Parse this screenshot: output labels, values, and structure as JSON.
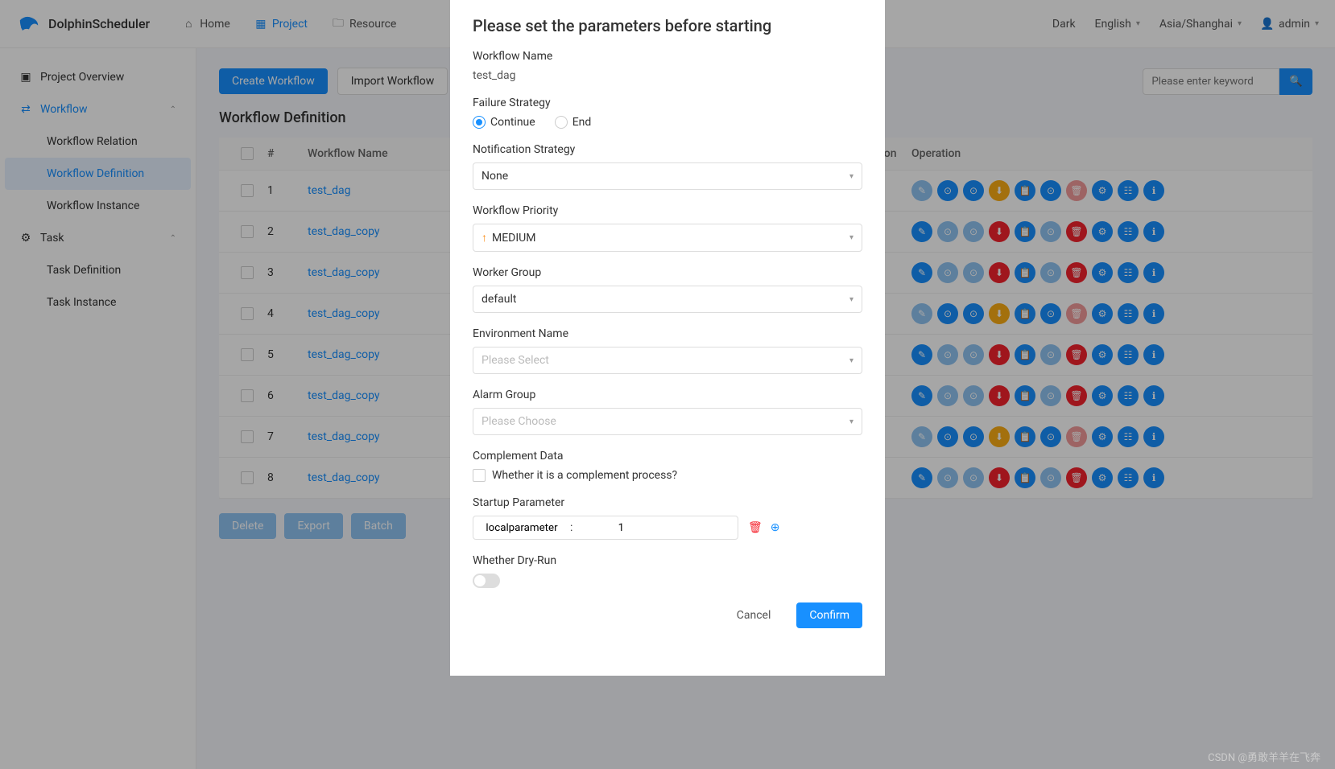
{
  "brand": "DolphinScheduler",
  "topnav": {
    "home": "Home",
    "project": "Project",
    "resource": "Resource"
  },
  "topright": {
    "dark": "Dark",
    "lang": "English",
    "tz": "Asia/Shanghai",
    "user": "admin"
  },
  "sidebar": {
    "overview": "Project Overview",
    "workflow": "Workflow",
    "workflow_relation": "Workflow Relation",
    "workflow_definition": "Workflow Definition",
    "workflow_instance": "Workflow Instance",
    "task": "Task",
    "task_definition": "Task Definition",
    "task_instance": "Task Instance"
  },
  "page": {
    "title": "Workflow Definition",
    "create_btn": "Create Workflow",
    "import_btn": "Import Workflow",
    "search_placeholder": "Please enter keyword",
    "cols": {
      "num": "#",
      "name": "Workflow Name",
      "desc": "Description",
      "op": "Operation"
    },
    "rows": [
      {
        "n": "1",
        "name": "test_dag",
        "variant": "a"
      },
      {
        "n": "2",
        "name": "test_dag_copy",
        "variant": "b"
      },
      {
        "n": "3",
        "name": "test_dag_copy",
        "variant": "b"
      },
      {
        "n": "4",
        "name": "test_dag_copy",
        "variant": "a"
      },
      {
        "n": "5",
        "name": "test_dag_copy",
        "variant": "b"
      },
      {
        "n": "6",
        "name": "test_dag_copy",
        "variant": "b"
      },
      {
        "n": "7",
        "name": "test_dag_copy",
        "variant": "a"
      },
      {
        "n": "8",
        "name": "test_dag_copy",
        "variant": "b"
      }
    ],
    "footer": {
      "delete": "Delete",
      "export": "Export",
      "batch": "Batch"
    }
  },
  "modal": {
    "title": "Please set the parameters before starting",
    "workflow_name_label": "Workflow Name",
    "workflow_name_value": "test_dag",
    "failure_label": "Failure Strategy",
    "failure_continue": "Continue",
    "failure_end": "End",
    "notif_label": "Notification Strategy",
    "notif_value": "None",
    "priority_label": "Workflow Priority",
    "priority_value": "MEDIUM",
    "worker_label": "Worker Group",
    "worker_value": "default",
    "env_label": "Environment Name",
    "env_placeholder": "Please Select",
    "alarm_label": "Alarm Group",
    "alarm_placeholder": "Please Choose",
    "complement_label": "Complement Data",
    "complement_chk": "Whether it is a complement process?",
    "startup_label": "Startup Parameter",
    "param_key": "localparameter",
    "param_sep": ":",
    "param_val": "1",
    "dryrun_label": "Whether Dry-Run",
    "cancel": "Cancel",
    "confirm": "Confirm"
  },
  "watermark": "CSDN @勇敢羊羊在飞奔"
}
